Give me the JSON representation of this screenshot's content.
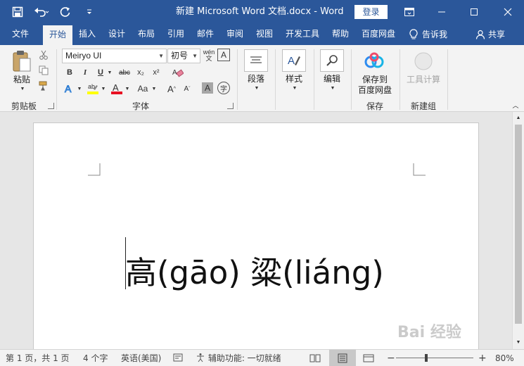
{
  "titlebar": {
    "title": "新建 Microsoft Word 文档.docx  -  Word",
    "login_label": "登录"
  },
  "tabs": [
    "文件",
    "开始",
    "插入",
    "设计",
    "布局",
    "引用",
    "邮件",
    "审阅",
    "视图",
    "开发工具",
    "帮助",
    "百度网盘"
  ],
  "active_tab": "开始",
  "tellme_label": "告诉我",
  "share_label": "共享",
  "ribbon": {
    "clipboard": {
      "paste_label": "粘贴",
      "group_label": "剪贴板"
    },
    "font": {
      "font_name": "Meiryo UI",
      "font_size": "初号",
      "group_label": "字体",
      "wen_label": "wén",
      "bold": "B",
      "italic": "I",
      "underline": "U",
      "strike": "abc",
      "subscript": "x₂",
      "superscript": "x²",
      "aa_label": "Aa",
      "grow": "A",
      "shrink": "A",
      "char_shade": "A",
      "circle_char": "字"
    },
    "paragraph": {
      "label": "段落"
    },
    "styles": {
      "label": "样式"
    },
    "editing": {
      "label": "编辑"
    },
    "save": {
      "button_label_1": "保存到",
      "button_label_2": "百度网盘",
      "group_label": "保存"
    },
    "newgroup": {
      "button_label": "工具计算",
      "group_label": "新建组"
    }
  },
  "document": {
    "text": "高(gāo)  粱(liáng)"
  },
  "watermark": "Bai 经验",
  "statusbar": {
    "page": "第 1 页，共 1 页",
    "words": "4 个字",
    "language": "英语(美国)",
    "accessibility": "辅助功能: 一切就绪",
    "zoom_minus": "−",
    "zoom_plus": "+",
    "zoom": "80%"
  },
  "zoom_level": 0.8,
  "colors": {
    "brand": "#2b579a",
    "highlight": "#ffff00",
    "font_color": "#e81123"
  }
}
